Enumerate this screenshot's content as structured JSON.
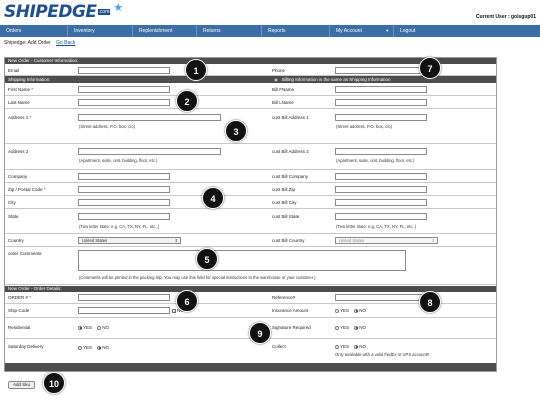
{
  "header": {
    "logo_text": "SHIPEDGE",
    "logo_suffix": ".com",
    "current_user": "Current User : golsgup01"
  },
  "nav": {
    "items": [
      {
        "label": "Orders"
      },
      {
        "label": "Inventory"
      },
      {
        "label": "Replenishment"
      },
      {
        "label": "Returns"
      },
      {
        "label": "Reports"
      },
      {
        "label": "My Account"
      },
      {
        "label": "Logout"
      }
    ],
    "dropdown_arrow": "▼"
  },
  "breadcrumb": {
    "text": "Shipedge: Add Order",
    "back_link": "Go Back"
  },
  "customer_section": {
    "title": "New Order - Customer Information:",
    "email_label": "Email",
    "phone_label": "Phone",
    "shipping_title": "Shipping Information:",
    "billing_same_label": "Billing Information is the same as Shipping Information"
  },
  "shipping": {
    "first_name": "First Name",
    "last_name": "Last Name",
    "address1": "Address 1",
    "address1_hint": "(Street address, P.O. box, c/o)",
    "address2": "Address 2",
    "address2_hint": "(Apartment, suite, unit, building, floor, etc.)",
    "company": "Company",
    "zip": "Zip / Postal Code",
    "city": "City",
    "state": "State",
    "state_hint": "(Two letter state: e.g. CA, TX, NY, FL, etc..)",
    "country": "Country",
    "country_value": "United States"
  },
  "billing": {
    "first_name": "Bill FName",
    "last_name": "Bill LName",
    "address1": "cust Bill Address 1",
    "address1_hint": "(Street address, P.O. box, c/o)",
    "address2": "cust Bill Address 2",
    "address2_hint": "(Apartment, suite, unit, building, floor, etc.)",
    "company": "cust Bill Company",
    "zip": "cust Bill Zip",
    "city": "cust Bill City",
    "state": "cust Bill State",
    "state_hint": "(Two letter state: e.g. CA, TX, NY, FL, etc..)",
    "country": "cust Bill Country",
    "country_value": "United States"
  },
  "comments": {
    "label": "order Comments",
    "hint": "(Comments will be printed in the packing slip. You may use this field for special instructions to the warehouse or your customer.)"
  },
  "order_section": {
    "title": "New Order - Order Details:",
    "order_number": "ORDER #",
    "reference": "Reference#",
    "ship_code": "Ship-Code",
    "ship_code_no": "NO",
    "insurance": "Insurance Amount",
    "residential": "Residential",
    "signature": "Signature Required",
    "saturday": "Saturday Delivery",
    "collect": "Collect",
    "collect_note": "Only available with a valid FedEx or UPS account#",
    "yes": "YES",
    "no": "NO"
  },
  "actions": {
    "add_sku": "Add Sku"
  },
  "markers": [
    "1",
    "2",
    "3",
    "4",
    "5",
    "6",
    "7",
    "8",
    "9",
    "10"
  ],
  "colors": {
    "nav_bg": "#3a6ea5",
    "section_bar": "#4d4d4d",
    "brand": "#1f4f8f",
    "required": "#cc0000"
  }
}
